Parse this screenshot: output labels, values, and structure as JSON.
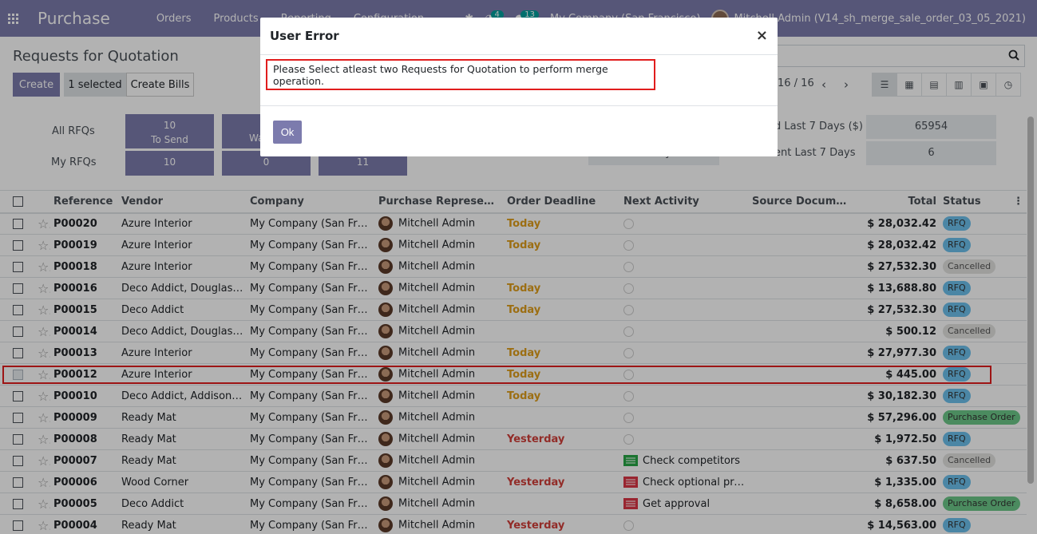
{
  "app": {
    "title": "Purchase",
    "menu": [
      "Orders",
      "Products",
      "Reporting",
      "Configuration"
    ],
    "activity_count": "4",
    "message_count": "13",
    "company": "My Company (San Francisco)",
    "user": "Mitchell Admin (V14_sh_merge_sale_order_03_05_2021)"
  },
  "control_panel": {
    "title": "Requests for Quotation",
    "create_label": "Create",
    "selected_label": "1 selected",
    "create_bills_label": "Create Bills",
    "pager": "16 / 16"
  },
  "dashboard": {
    "all_rfqs_label": "All RFQs",
    "my_rfqs_label": "My RFQs",
    "tile1_count": "10",
    "tile1_label": "To Send",
    "tile2_label": "Wa",
    "my_tile1": "10",
    "my_tile2": "0",
    "my_tile3": "11",
    "stat1_label": "d Last 7 Days ($)",
    "stat1_value": "65954",
    "stat2_label": "ent Last 7 Days",
    "stat2_value": "6",
    "stat_hidden": "y"
  },
  "table": {
    "headers": [
      "Reference",
      "Vendor",
      "Company",
      "Purchase Representat...",
      "Order Deadline",
      "Next Activity",
      "Source Document",
      "Total",
      "Status"
    ],
    "rows": [
      {
        "ref": "P00020",
        "vendor": "Azure Interior",
        "company": "My Company (San Fran...",
        "rep": "Mitchell Admin",
        "deadline": "Today",
        "activity": "",
        "total": "$ 28,032.42",
        "status": "RFQ"
      },
      {
        "ref": "P00019",
        "vendor": "Azure Interior",
        "company": "My Company (San Fran...",
        "rep": "Mitchell Admin",
        "deadline": "Today",
        "activity": "",
        "total": "$ 28,032.42",
        "status": "RFQ"
      },
      {
        "ref": "P00018",
        "vendor": "Azure Interior",
        "company": "My Company (San Fran...",
        "rep": "Mitchell Admin",
        "deadline": "",
        "activity": "",
        "total": "$ 27,532.30",
        "status": "Cancelled"
      },
      {
        "ref": "P00016",
        "vendor": "Deco Addict, Douglas Fl...",
        "company": "My Company (San Fran...",
        "rep": "Mitchell Admin",
        "deadline": "Today",
        "activity": "",
        "total": "$ 13,688.80",
        "status": "RFQ"
      },
      {
        "ref": "P00015",
        "vendor": "Deco Addict",
        "company": "My Company (San Fran...",
        "rep": "Mitchell Admin",
        "deadline": "Today",
        "activity": "",
        "total": "$ 27,532.30",
        "status": "RFQ"
      },
      {
        "ref": "P00014",
        "vendor": "Deco Addict, Douglas Fl...",
        "company": "My Company (San Fran...",
        "rep": "Mitchell Admin",
        "deadline": "",
        "activity": "",
        "total": "$ 500.12",
        "status": "Cancelled"
      },
      {
        "ref": "P00013",
        "vendor": "Azure Interior",
        "company": "My Company (San Fran...",
        "rep": "Mitchell Admin",
        "deadline": "Today",
        "activity": "",
        "total": "$ 27,977.30",
        "status": "RFQ"
      },
      {
        "ref": "P00012",
        "vendor": "Azure Interior",
        "company": "My Company (San Fran...",
        "rep": "Mitchell Admin",
        "deadline": "Today",
        "activity": "",
        "total": "$ 445.00",
        "status": "RFQ"
      },
      {
        "ref": "P00010",
        "vendor": "Deco Addict, Addison Ol...",
        "company": "My Company (San Fran...",
        "rep": "Mitchell Admin",
        "deadline": "Today",
        "activity": "",
        "total": "$ 30,182.30",
        "status": "RFQ"
      },
      {
        "ref": "P00009",
        "vendor": "Ready Mat",
        "company": "My Company (San Fran...",
        "rep": "Mitchell Admin",
        "deadline": "",
        "activity": "",
        "total": "$ 57,296.00",
        "status": "Purchase Order"
      },
      {
        "ref": "P00008",
        "vendor": "Ready Mat",
        "company": "My Company (San Fran...",
        "rep": "Mitchell Admin",
        "deadline": "Yesterday",
        "activity": "",
        "total": "$ 1,972.50",
        "status": "RFQ"
      },
      {
        "ref": "P00007",
        "vendor": "Ready Mat",
        "company": "My Company (San Fran...",
        "rep": "Mitchell Admin",
        "deadline": "",
        "activity": "Check competitors",
        "total": "$ 637.50",
        "status": "Cancelled"
      },
      {
        "ref": "P00006",
        "vendor": "Wood Corner",
        "company": "My Company (San Fran...",
        "rep": "Mitchell Admin",
        "deadline": "Yesterday",
        "activity": "Check optional pro...",
        "total": "$ 1,335.00",
        "status": "RFQ"
      },
      {
        "ref": "P00005",
        "vendor": "Deco Addict",
        "company": "My Company (San Fran...",
        "rep": "Mitchell Admin",
        "deadline": "",
        "activity": "Get approval",
        "total": "$ 8,658.00",
        "status": "Purchase Order"
      },
      {
        "ref": "P00004",
        "vendor": "Ready Mat",
        "company": "My Company (San Fran...",
        "rep": "Mitchell Admin",
        "deadline": "Yesterday",
        "activity": "",
        "total": "$ 14,563.00",
        "status": "RFQ"
      }
    ],
    "selected_index": 7
  },
  "modal": {
    "title": "User Error",
    "close_symbol": "×",
    "message": "Please Select atleast two Requests for Quotation to perform merge operation.",
    "ok_label": "Ok"
  },
  "colors": {
    "brand": "#7c7bad",
    "highlight": "#e11d1d"
  }
}
